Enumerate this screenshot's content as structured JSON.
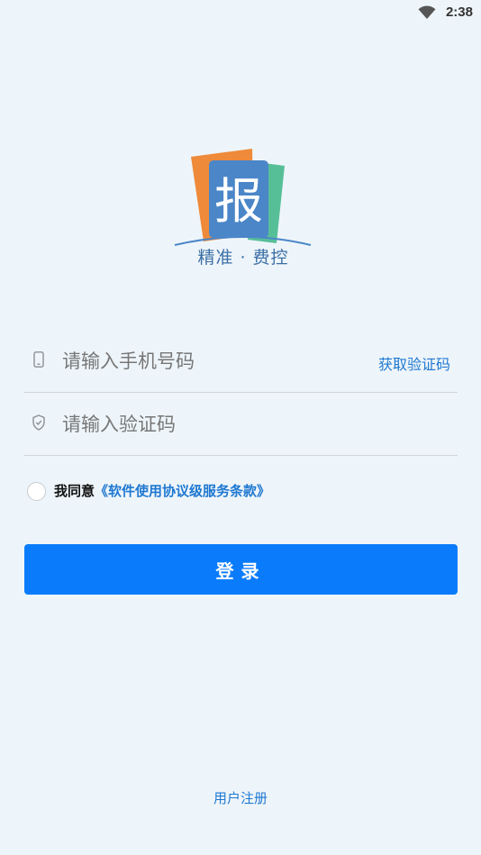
{
  "status_bar": {
    "time": "2:38",
    "wifi_icon": "wifi-icon"
  },
  "logo": {
    "glyph": "报",
    "slogan": "精准 · 费控",
    "colors": {
      "orange": "#ee8a3a",
      "green": "#57bf98",
      "blue": "#4a86c8"
    }
  },
  "phone_field": {
    "placeholder": "请输入手机号码",
    "value": "",
    "icon": "phone-icon",
    "action_label": "获取验证码"
  },
  "code_field": {
    "placeholder": "请输入验证码",
    "value": "",
    "icon": "shield-icon"
  },
  "agreement": {
    "prefix": "我同意",
    "link_text": "《软件使用协议级服务条款》",
    "checked": false
  },
  "login_button": {
    "label": "登录"
  },
  "register_link": {
    "label": "用户注册"
  },
  "colors": {
    "accent": "#0a7cfb",
    "link": "#1f78d1",
    "background": "#eef5fa"
  }
}
